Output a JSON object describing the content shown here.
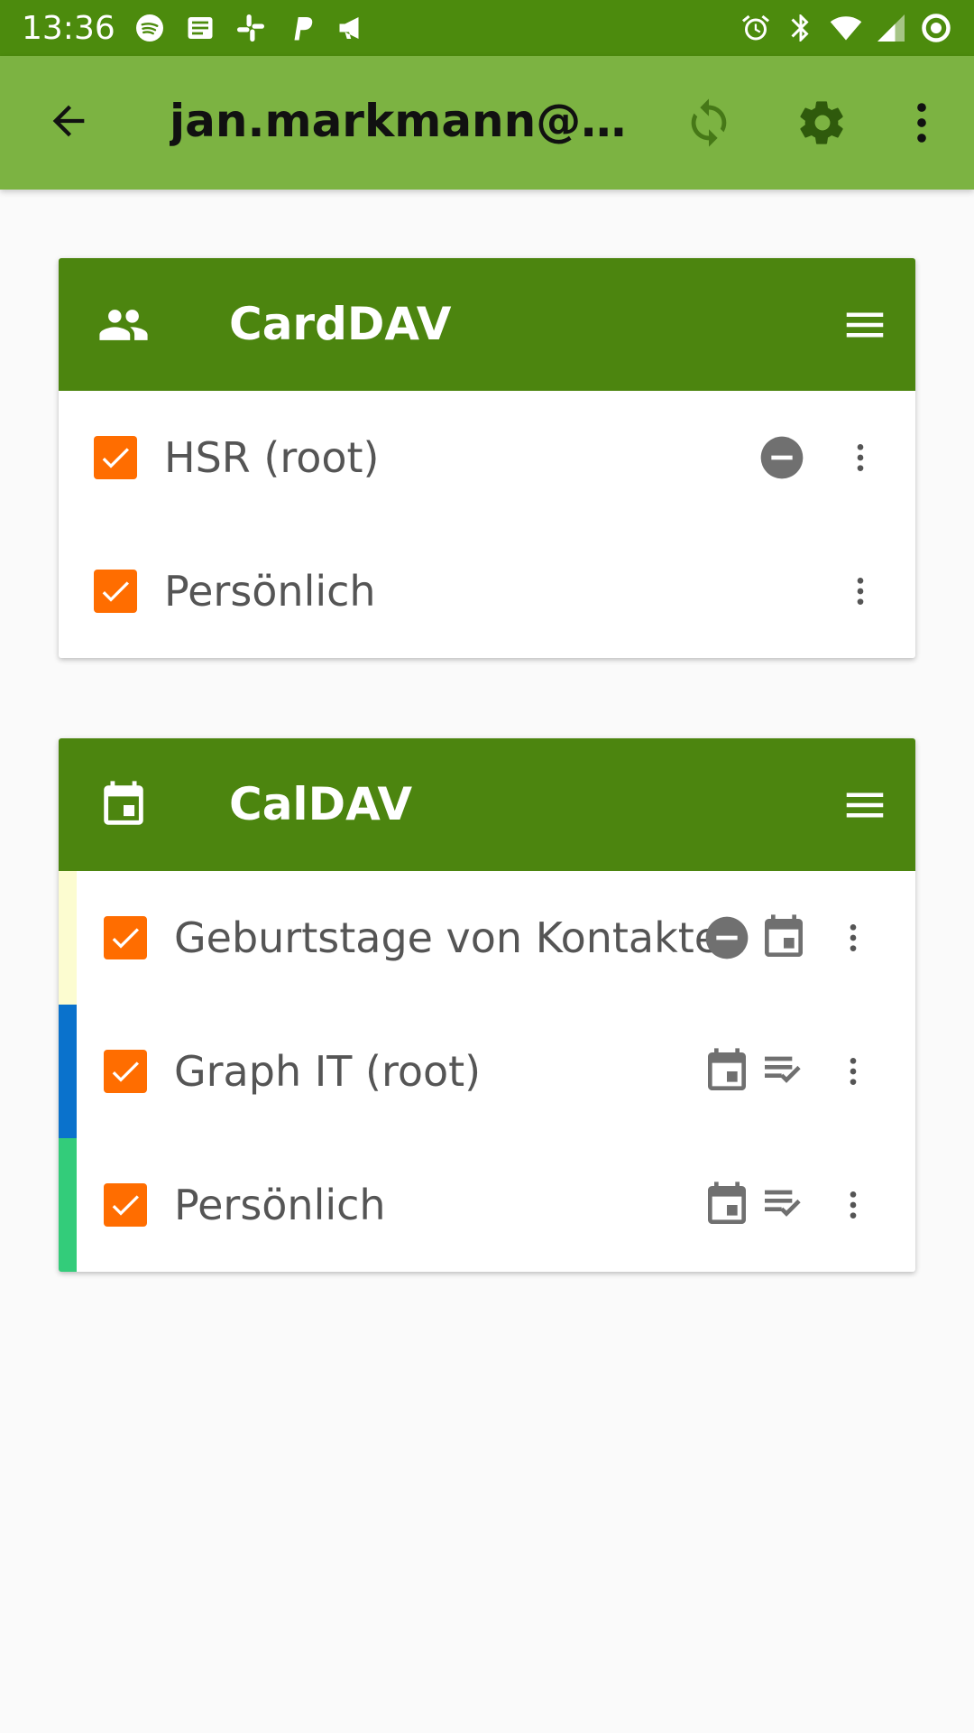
{
  "status_bar": {
    "time": "13:36",
    "left_icons": [
      "spotify-icon",
      "news-icon",
      "slack-icon",
      "paypal-icon",
      "megaphone-icon"
    ],
    "right_icons": [
      "alarm-icon",
      "bluetooth-icon",
      "wifi-icon",
      "signal-icon",
      "battery-ring-icon"
    ]
  },
  "app_bar": {
    "title": "jan.markmann@g...",
    "back_icon": "arrow-back-icon",
    "actions": [
      "sync-icon",
      "settings-icon",
      "overflow-menu-icon"
    ]
  },
  "carddav": {
    "title": "CardDAV",
    "icon": "contacts-icon",
    "items": [
      {
        "label": "HSR (root)",
        "checked": true,
        "badges": [
          "read-only-icon"
        ]
      },
      {
        "label": "Persönlich",
        "checked": true,
        "badges": []
      }
    ]
  },
  "caldav": {
    "title": "CalDAV",
    "icon": "calendar-icon",
    "items": [
      {
        "label": "Geburtstage von Kontakten",
        "checked": true,
        "color": "#fcfcd0",
        "badges": [
          "read-only-icon",
          "calendar-icon"
        ]
      },
      {
        "label": "Graph IT (root)",
        "checked": true,
        "color": "#0a72cc",
        "badges": [
          "calendar-icon",
          "tasks-icon"
        ]
      },
      {
        "label": "Persönlich",
        "checked": true,
        "color": "#33cc7a",
        "badges": [
          "calendar-icon",
          "tasks-icon"
        ]
      }
    ]
  },
  "colors": {
    "status_bar": "#4c8b0d",
    "app_bar": "#7cb342",
    "card_header": "#4c850f",
    "checkbox": "#ff6d00",
    "background": "#fafafa"
  }
}
